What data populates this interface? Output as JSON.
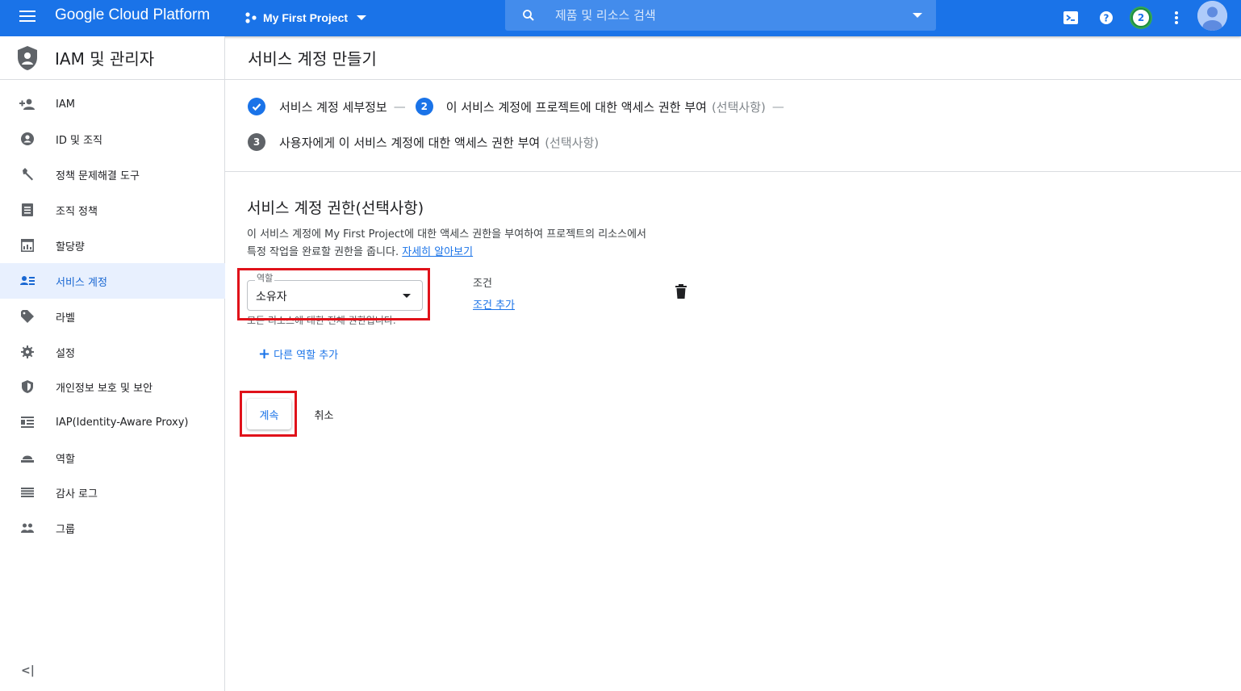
{
  "topbar": {
    "brand": "Google Cloud Platform",
    "project": "My First Project",
    "search_placeholder": "제품 및 리소스 검색",
    "notification_count": "2",
    "bg_color": "#1a73e8"
  },
  "sidebar": {
    "title": "IAM 및 관리자",
    "items": [
      {
        "label": "IAM",
        "icon": "person-add-icon"
      },
      {
        "label": "ID 및 조직",
        "icon": "account-circle-icon"
      },
      {
        "label": "정책 문제해결 도구",
        "icon": "wrench-icon"
      },
      {
        "label": "조직 정책",
        "icon": "list-document-icon"
      },
      {
        "label": "할당량",
        "icon": "quota-icon"
      },
      {
        "label": "서비스 계정",
        "icon": "service-account-icon",
        "active": true
      },
      {
        "label": "라벨",
        "icon": "label-icon"
      },
      {
        "label": "설정",
        "icon": "gear-icon"
      },
      {
        "label": "개인정보 보호 및 보안",
        "icon": "privacy-shield-icon"
      },
      {
        "label": "IAP(Identity-Aware Proxy)",
        "icon": "iap-icon"
      },
      {
        "label": "역할",
        "icon": "roles-icon"
      },
      {
        "label": "감사 로그",
        "icon": "audit-log-icon"
      },
      {
        "label": "그룹",
        "icon": "group-icon"
      }
    ],
    "collapse_label": "<|"
  },
  "main": {
    "page_title": "서비스 계정 만들기",
    "steps": {
      "step1_label": "서비스 계정 세부정보",
      "step2_number": "2",
      "step2_label": "이 서비스 계정에 프로젝트에 대한 액세스 권한 부여",
      "step2_optional": "(선택사항)",
      "step3_number": "3",
      "step3_label": "사용자에게 이 서비스 계정에 대한 액세스 권한 부여",
      "step3_optional": "(선택사항)",
      "separator": "—"
    },
    "section_title": "서비스 계정 권한(선택사항)",
    "description_line1": "이 서비스 계정에 My First Project에 대한 액세스 권한을 부여하여 프로젝트의 리소스에서",
    "description_line2": "특정 작업을 완료할 권한을 줍니다.",
    "learn_more": "자세히 알아보기",
    "role": {
      "label": "역할",
      "value": "소유자",
      "hint": "모든 리소스에 대한 전체 권한입니다."
    },
    "condition": {
      "label": "조건",
      "add_link": "조건 추가"
    },
    "add_role": "다른 역할 추가",
    "continue_button": "계속",
    "cancel_button": "취소"
  }
}
